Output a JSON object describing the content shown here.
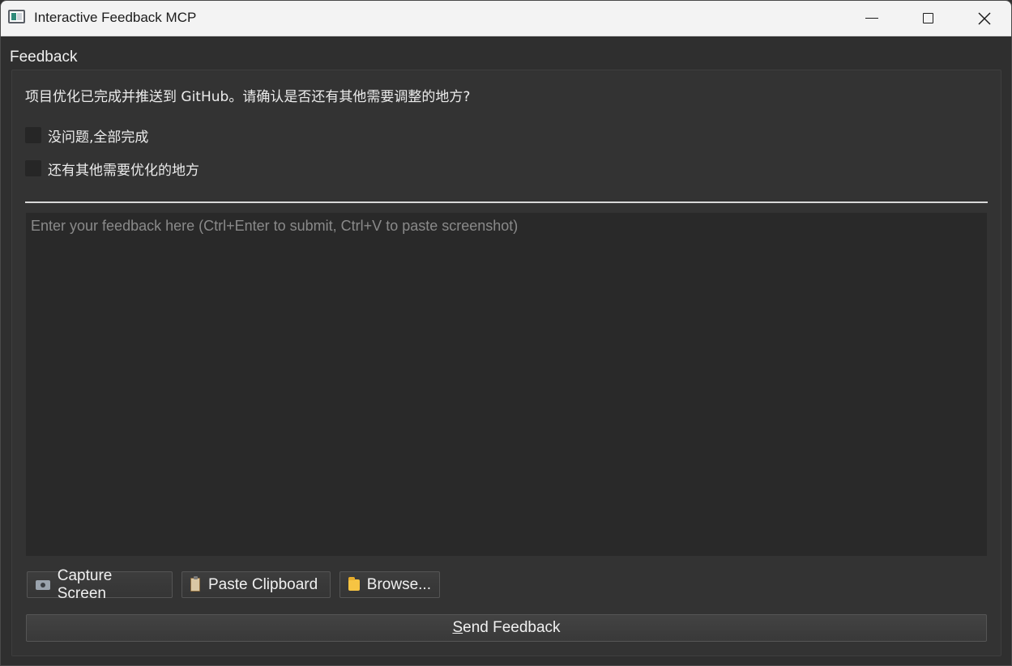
{
  "window": {
    "title": "Interactive Feedback MCP"
  },
  "group": {
    "label": "Feedback"
  },
  "question": "项目优化已完成并推送到 GitHub。请确认是否还有其他需要调整的地方?",
  "options": [
    {
      "label": "没问题,全部完成",
      "checked": false
    },
    {
      "label": "还有其他需要优化的地方",
      "checked": false
    }
  ],
  "feedback_input": {
    "value": "",
    "placeholder": "Enter your feedback here (Ctrl+Enter to submit, Ctrl+V to paste screenshot)"
  },
  "toolbar": {
    "capture_label": "Capture Screen",
    "paste_label": "Paste Clipboard",
    "browse_label": "Browse..."
  },
  "send": {
    "mnemonic": "S",
    "rest": "end Feedback"
  },
  "colors": {
    "background": "#2f2f2f",
    "titlebar": "#f3f3f3",
    "input_bg": "#292929",
    "text": "#ececec"
  }
}
